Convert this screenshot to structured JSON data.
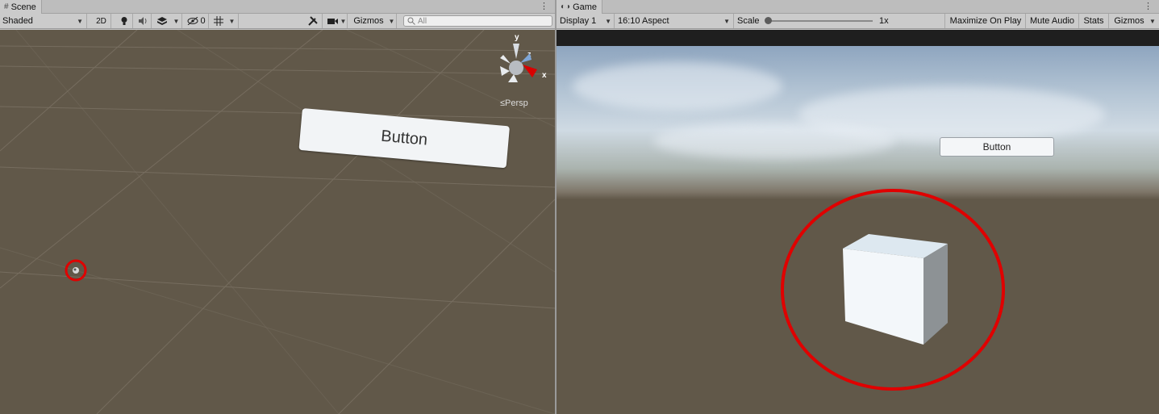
{
  "scene": {
    "tab_label": "Scene",
    "shading_mode": "Shaded",
    "toggle_2d": "2D",
    "hidden_count": "0",
    "gizmos_label": "Gizmos",
    "search_placeholder": "All",
    "projection_label": "Persp",
    "gizmo_axes": {
      "y": "y",
      "z": "z",
      "x": "x"
    },
    "world_button_text": "Button"
  },
  "game": {
    "tab_label": "Game",
    "display": "Display 1",
    "aspect": "16:10 Aspect",
    "scale_label": "Scale",
    "scale_value": "1x",
    "maximize_label": "Maximize On Play",
    "mute_label": "Mute Audio",
    "stats_label": "Stats",
    "gizmos_label": "Gizmos",
    "ui_button_text": "Button"
  },
  "colors": {
    "ground": "#615849",
    "highlight_circle": "#e00000",
    "toolbar_bg": "#cbcbcb"
  },
  "icons": [
    "scene-tab-icon",
    "lightbulb-icon",
    "audio-icon",
    "effects-icon",
    "visibility-icon",
    "grid-icon",
    "tools-icon",
    "camera-icon",
    "search-icon",
    "game-tab-icon",
    "orientation-gizmo-icon",
    "light-gizmo-icon"
  ]
}
